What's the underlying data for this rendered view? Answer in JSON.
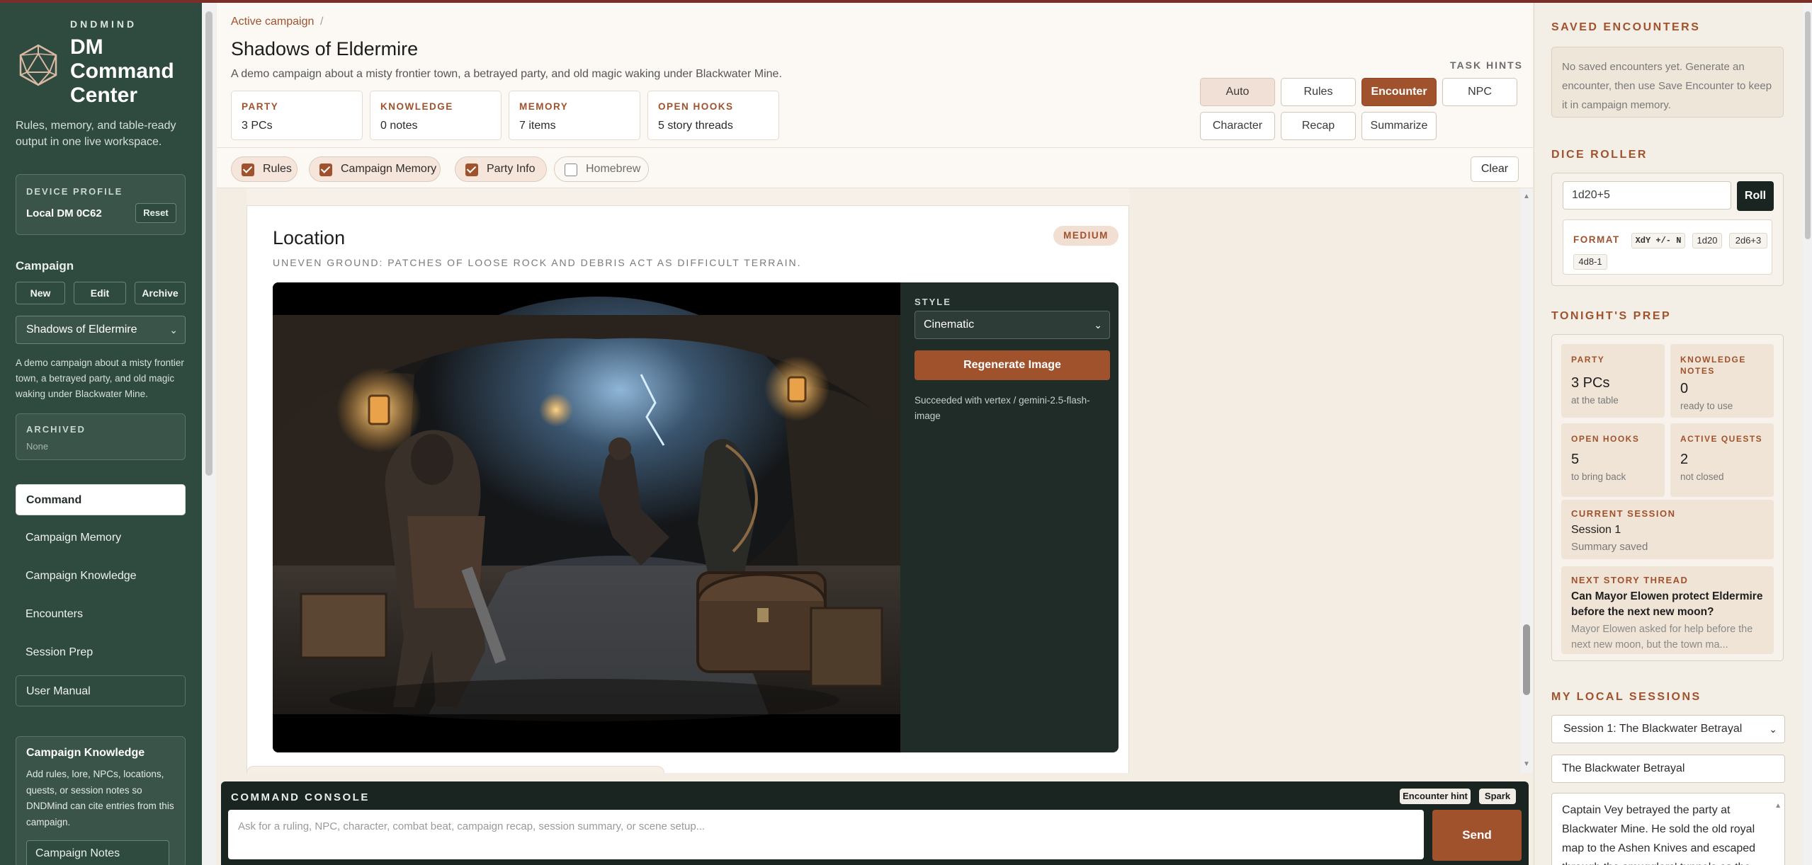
{
  "sidebar": {
    "brand_small": "DNDMIND",
    "brand_title": "DM Command Center",
    "tagline": "Rules, memory, and table-ready output in one live workspace.",
    "device": {
      "label": "DEVICE PROFILE",
      "name": "Local DM 0C62",
      "reset": "Reset"
    },
    "campaign_heading": "Campaign",
    "campaign_buttons": {
      "new": "New",
      "edit": "Edit",
      "archive": "Archive"
    },
    "campaign_select": "Shadows of Eldermire",
    "campaign_desc": "A demo campaign about a misty frontier town, a betrayed party, and old magic waking under Blackwater Mine.",
    "archived": {
      "label": "ARCHIVED",
      "value": "None"
    },
    "nav": [
      "Command",
      "Campaign Memory",
      "Campaign Knowledge",
      "Encounters",
      "Session Prep",
      "User Manual"
    ],
    "knowledge_box": {
      "title": "Campaign Knowledge",
      "desc": "Add rules, lore, NPCs, locations, quests, or session notes so DNDMind can cite entries from this campaign.",
      "notes": "Campaign Notes"
    }
  },
  "header": {
    "breadcrumb": "Active campaign",
    "breadcrumb_sep": "/",
    "title": "Shadows of Eldermire",
    "subtitle": "A demo campaign about a misty frontier town, a betrayed party, and old magic waking under Blackwater Mine.",
    "stats": [
      {
        "label": "PARTY",
        "value": "3 PCs"
      },
      {
        "label": "KNOWLEDGE",
        "value": "0 notes"
      },
      {
        "label": "MEMORY",
        "value": "7 items"
      },
      {
        "label": "OPEN HOOKS",
        "value": "5 story threads"
      }
    ],
    "task_hints_label": "TASK HINTS",
    "task_hints": [
      "Auto",
      "Rules",
      "Encounter",
      "NPC",
      "Character",
      "Recap",
      "Summarize"
    ],
    "active_hint": "Encounter"
  },
  "filters": {
    "chips": [
      {
        "label": "Rules",
        "checked": true
      },
      {
        "label": "Campaign Memory",
        "checked": true
      },
      {
        "label": "Party Info",
        "checked": true
      },
      {
        "label": "Homebrew",
        "checked": false
      }
    ],
    "clear": "Clear"
  },
  "location_card": {
    "title": "Location",
    "badge": "MEDIUM",
    "subtitle": "UNEVEN GROUND: PATCHES OF LOOSE ROCK AND DEBRIS ACT AS DIFFICULT TERRAIN.",
    "style_label": "STYLE",
    "style_value": "Cinematic",
    "regenerate": "Regenerate Image",
    "status": "Succeeded with vertex / gemini-2.5-flash-image"
  },
  "console": {
    "title": "COMMAND CONSOLE",
    "tag_hint": "Encounter hint",
    "tag_spark": "Spark",
    "placeholder": "Ask for a ruling, NPC, character, combat beat, campaign recap, session summary, or scene setup...",
    "send": "Send"
  },
  "right": {
    "saved_heading": "SAVED ENCOUNTERS",
    "saved_empty": "No saved encounters yet. Generate an encounter, then use Save Encounter to keep it in campaign memory.",
    "dice_heading": "DICE ROLLER",
    "dice_value": "1d20+5",
    "roll": "Roll",
    "format_label": "FORMAT",
    "format_chips": [
      "XdY +/- N",
      "1d20",
      "2d6+3",
      "4d8-1"
    ],
    "prep_heading": "TONIGHT'S PREP",
    "tiles": [
      {
        "label": "PARTY",
        "value": "3 PCs",
        "sub": "at the table"
      },
      {
        "label": "KNOWLEDGE NOTES",
        "value": "0",
        "sub": "ready to use"
      },
      {
        "label": "OPEN HOOKS",
        "value": "5",
        "sub": "to bring back"
      },
      {
        "label": "ACTIVE QUESTS",
        "value": "2",
        "sub": "not closed"
      }
    ],
    "current_session": {
      "label": "CURRENT SESSION",
      "value": "Session 1",
      "sub": "Summary saved"
    },
    "next_thread": {
      "label": "NEXT STORY THREAD",
      "value": "Can Mayor Elowen protect Eldermire before the next new moon?",
      "sub": "Mayor Elowen asked for help before the next new moon, but the town ma..."
    },
    "sessions_heading": "MY LOCAL SESSIONS",
    "session_select": "Session 1: The Blackwater Betrayal",
    "session_title": "The Blackwater Betrayal",
    "session_body": "Captain Vey betrayed the party at Blackwater Mine. He sold the old royal map to the Ashen Knives and escaped through the smugglers' tunnels as the"
  }
}
